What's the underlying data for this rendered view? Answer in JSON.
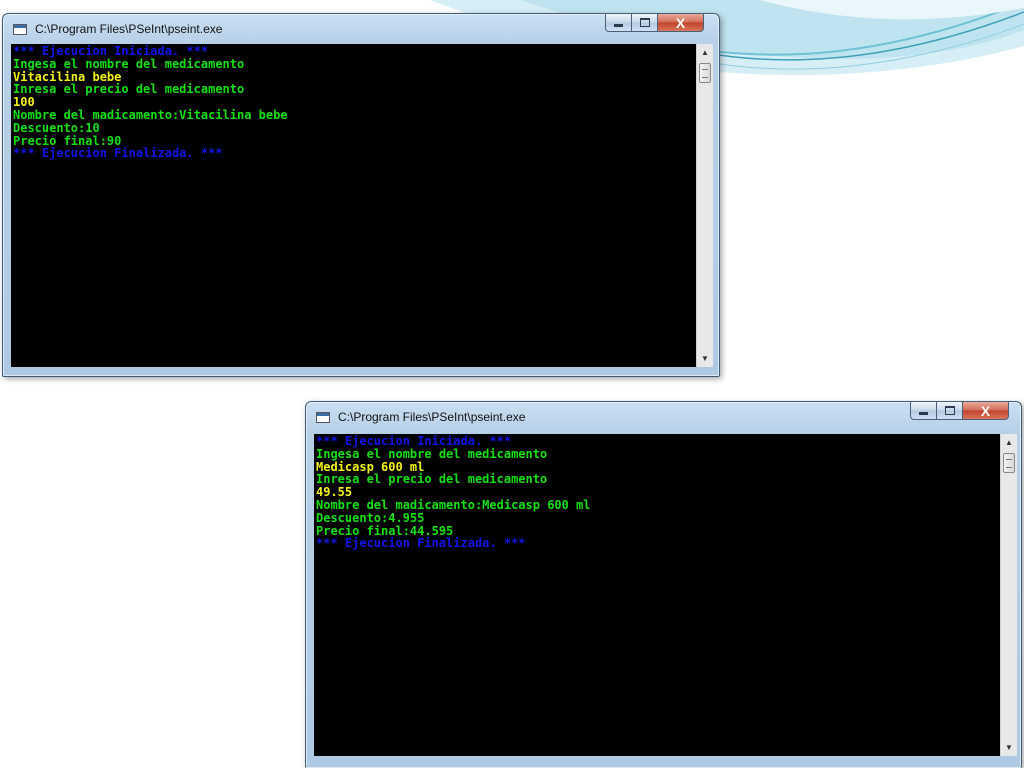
{
  "colors": {
    "console_bg": "#000000",
    "text_blue": "#1414e8",
    "text_green": "#14e014",
    "text_yellow": "#f4f414",
    "slide_accent": "#5fb3c8"
  },
  "windows": [
    {
      "title": "C:\\Program Files\\PSeInt\\pseint.exe",
      "buttons": {
        "minimize": "minimize-icon",
        "maximize": "maximize-icon",
        "close": "X"
      },
      "console_lines": [
        {
          "text": "*** Ejecucion Iniciada. ***",
          "color": "blue"
        },
        {
          "text": "Ingesa el nombre del medicamento",
          "color": "green"
        },
        {
          "text": "Vitacilina bebe",
          "color": "yellow"
        },
        {
          "text": "Inresa el precio del medicamento",
          "color": "green"
        },
        {
          "text": "100",
          "color": "yellow"
        },
        {
          "text": "Nombre del madicamento:Vitacilina bebe",
          "color": "green"
        },
        {
          "text": "Descuento:10",
          "color": "green"
        },
        {
          "text": "Precio final:90",
          "color": "green"
        },
        {
          "text": "*** Ejecucion Finalizada. ***",
          "color": "blue"
        }
      ]
    },
    {
      "title": "C:\\Program Files\\PSeInt\\pseint.exe",
      "buttons": {
        "minimize": "minimize-icon",
        "maximize": "maximize-icon",
        "close": "X"
      },
      "console_lines": [
        {
          "text": "*** Ejecucion Iniciada. ***",
          "color": "blue"
        },
        {
          "text": "Ingesa el nombre del medicamento",
          "color": "green"
        },
        {
          "text": "Medicasp 600 ml",
          "color": "yellow"
        },
        {
          "text": "Inresa el precio del medicamento",
          "color": "green"
        },
        {
          "text": "49.55",
          "color": "yellow"
        },
        {
          "text": "Nombre del madicamento:Medicasp 600 ml",
          "color": "green"
        },
        {
          "text": "Descuento:4.955",
          "color": "green"
        },
        {
          "text": "Precio final:44.595",
          "color": "green"
        },
        {
          "text": "*** Ejecucion Finalizada. ***",
          "color": "blue"
        }
      ]
    }
  ]
}
